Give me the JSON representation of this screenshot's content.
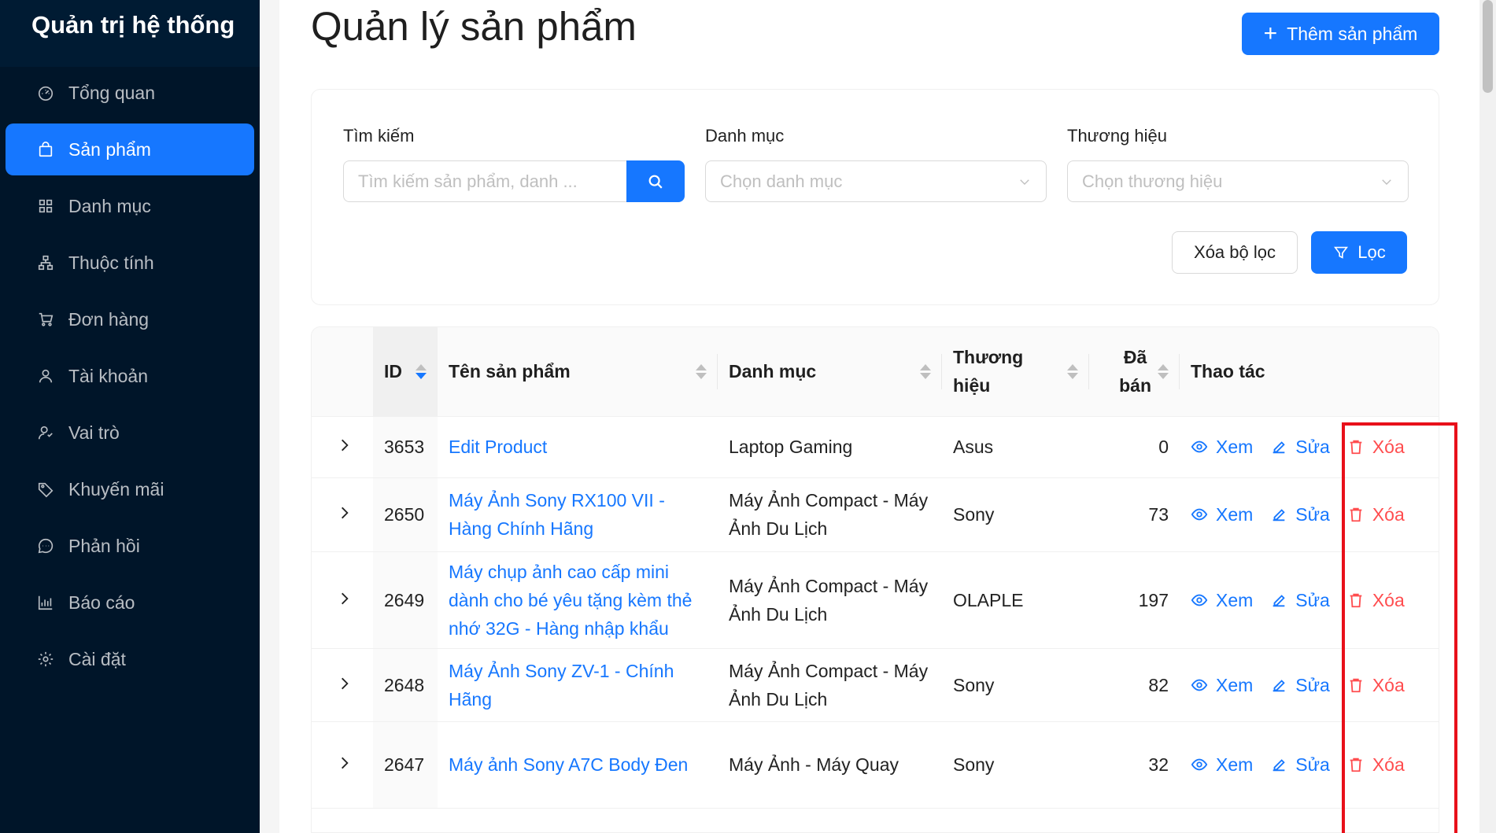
{
  "sidebar": {
    "title": "Quản trị hệ thống",
    "items": [
      {
        "label": "Tổng quan",
        "icon": "dashboard-icon"
      },
      {
        "label": "Sản phẩm",
        "icon": "shopping-bag-icon",
        "active": true
      },
      {
        "label": "Danh mục",
        "icon": "grid-icon"
      },
      {
        "label": "Thuộc tính",
        "icon": "cluster-icon"
      },
      {
        "label": "Đơn hàng",
        "icon": "cart-icon"
      },
      {
        "label": "Tài khoản",
        "icon": "user-icon"
      },
      {
        "label": "Vai trò",
        "icon": "user-role-icon"
      },
      {
        "label": "Khuyến mãi",
        "icon": "tag-icon"
      },
      {
        "label": "Phản hồi",
        "icon": "chat-icon"
      },
      {
        "label": "Báo cáo",
        "icon": "bar-chart-icon"
      },
      {
        "label": "Cài đặt",
        "icon": "gear-icon"
      }
    ]
  },
  "page": {
    "title": "Quản lý sản phẩm",
    "add_button": "Thêm sản phẩm"
  },
  "filters": {
    "search_label": "Tìm kiếm",
    "search_placeholder": "Tìm kiếm sản phẩm, danh ...",
    "category_label": "Danh mục",
    "category_placeholder": "Chọn danh mục",
    "brand_label": "Thương hiệu",
    "brand_placeholder": "Chọn thương hiệu",
    "clear_button": "Xóa bộ lọc",
    "filter_button": "Lọc"
  },
  "table": {
    "columns": {
      "id": "ID",
      "name": "Tên sản phẩm",
      "category": "Danh mục",
      "brand_line1": "Thương",
      "brand_line2": "hiệu",
      "sold_line1": "Đã",
      "sold_line2": "bán",
      "actions": "Thao tác"
    },
    "action_labels": {
      "view": "Xem",
      "edit": "Sửa",
      "delete": "Xóa"
    },
    "rows": [
      {
        "id": "3653",
        "name": "Edit Product",
        "category": "Laptop Gaming",
        "brand": "Asus",
        "sold": "0"
      },
      {
        "id": "2650",
        "name": "Máy Ảnh Sony RX100 VII - Hàng Chính Hãng",
        "category": "Máy Ảnh Compact - Máy Ảnh Du Lịch",
        "brand": "Sony",
        "sold": "73"
      },
      {
        "id": "2649",
        "name": "Máy chụp ảnh cao cấp mini dành cho bé yêu tặng kèm thẻ nhớ 32G - Hàng nhập khẩu",
        "category": "Máy Ảnh Compact - Máy Ảnh Du Lịch",
        "brand": "OLAPLE",
        "sold": "197"
      },
      {
        "id": "2648",
        "name": "Máy Ảnh Sony ZV-1 - Chính Hãng",
        "category": "Máy Ảnh Compact - Máy Ảnh Du Lịch",
        "brand": "Sony",
        "sold": "82"
      },
      {
        "id": "2647",
        "name": "Máy ảnh Sony A7C Body Đen",
        "category": "Máy Ảnh - Máy Quay",
        "brand": "Sony",
        "sold": "32"
      }
    ]
  },
  "colors": {
    "primary": "#1677ff",
    "danger": "#ff4d4f",
    "sidebar_bg": "#001529",
    "highlight": "#e8101a"
  }
}
